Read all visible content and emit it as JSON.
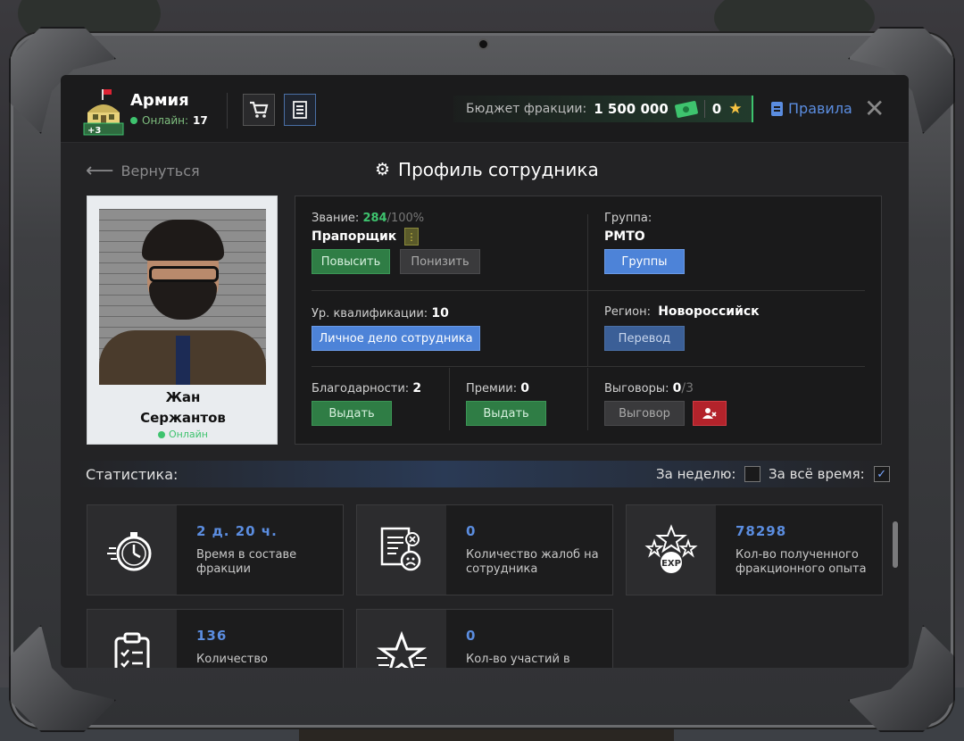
{
  "header": {
    "faction_name": "Армия",
    "online_label": "Онлайн:",
    "online_count": "17",
    "badge": "+3",
    "budget_label": "Бюджет фракции:",
    "budget_value": "1 500 000",
    "stars_value": "0",
    "rules_label": "Правила"
  },
  "nav": {
    "back_label": "Вернуться",
    "page_title": "Профиль сотрудника"
  },
  "employee": {
    "first_name": "Жан",
    "last_name": "Сержантов",
    "status": "Онлайн"
  },
  "info": {
    "rank_label": "Звание:",
    "rank_progress": "284",
    "rank_max": "/100%",
    "rank_name": "Прапорщик",
    "promote_btn": "Повысить",
    "demote_btn": "Понизить",
    "group_label": "Группа:",
    "group_value": "РМТО",
    "groups_btn": "Группы",
    "qual_label": "Ур. квалификации:",
    "qual_value": "10",
    "personal_file_btn": "Личное дело сотрудника",
    "region_label": "Регион:",
    "region_value": "Новороссийск",
    "transfer_btn": "Перевод",
    "thanks_label": "Благодарности:",
    "thanks_value": "2",
    "thanks_btn": "Выдать",
    "bonus_label": "Премии:",
    "bonus_value": "0",
    "bonus_btn": "Выдать",
    "warnings_label": "Выговоры:",
    "warnings_value": "0",
    "warnings_max": "/3",
    "warning_btn": "Выговор"
  },
  "stats": {
    "title": "Статистика:",
    "week_label": "За неделю:",
    "week_checked": false,
    "all_time_label": "За всё время:",
    "all_time_checked": true,
    "cards": [
      {
        "icon": "stopwatch-icon",
        "value": "2 д. 20 ч.",
        "label": "Время в составе фракции"
      },
      {
        "icon": "complaint-document-icon",
        "value": "0",
        "label": "Количество жалоб на сотрудника"
      },
      {
        "icon": "exp-stars-icon",
        "value": "78298",
        "label": "Кол-во полученного фракционного опыта"
      },
      {
        "icon": "clipboard-checklist-icon",
        "value": "136",
        "label": "Количество"
      },
      {
        "icon": "star-icon",
        "value": "0",
        "label": "Кол-во участий в"
      }
    ]
  },
  "colors": {
    "accent_blue": "#5b8de0",
    "green": "#3ec36e",
    "red": "#b3232b"
  }
}
